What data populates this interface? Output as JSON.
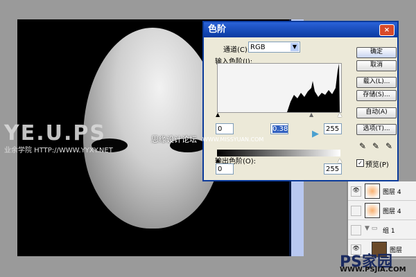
{
  "watermarks": {
    "yeups": "YE.U.PS",
    "yeups_sub": "业余学院 HTTP://WWW.YYXY.NET",
    "sy": "思缘设计论坛",
    "missyuan": "WWW.MISSYUAN.COM",
    "psjia": "PS家园",
    "psjia_url": "WWW.PSJIA.COM"
  },
  "dialog": {
    "title": "色阶",
    "close": "×",
    "channel_label": "通道(C):",
    "channel_value": "RGB",
    "input_label": "输入色阶(I):",
    "input_black": "0",
    "input_gamma": "0.38",
    "input_white": "255",
    "output_label": "输出色阶(O):",
    "output_black": "0",
    "output_white": "255",
    "buttons": {
      "ok": "确定",
      "cancel": "取消",
      "load": "载入(L)...",
      "save": "存储(S)...",
      "auto": "自动(A)",
      "options": "选项(T)..."
    },
    "preview_label": "预览(P)",
    "preview_checked": true
  },
  "layers": [
    {
      "name": "图层 4",
      "visible": true
    },
    {
      "name": "图层 4",
      "visible": false
    },
    {
      "name": "组 1",
      "visible": false,
      "group": true
    },
    {
      "name": "图层",
      "visible": true
    }
  ]
}
